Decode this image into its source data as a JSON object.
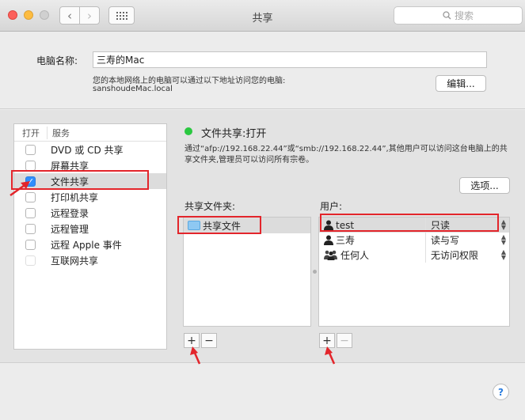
{
  "window": {
    "title": "共享",
    "search_placeholder": "搜索"
  },
  "computer": {
    "label": "电脑名称:",
    "name": "三寿的Mac",
    "hint": "您的本地网络上的电脑可以通过以下地址访问您的电脑:",
    "address": "sanshoudeMac.local",
    "edit_label": "编辑..."
  },
  "services": {
    "col_on": "打开",
    "col_service": "服务",
    "items": [
      {
        "label": "DVD 或 CD 共享",
        "checked": false
      },
      {
        "label": "屏幕共享",
        "checked": false
      },
      {
        "label": "文件共享",
        "checked": true
      },
      {
        "label": "打印机共享",
        "checked": false
      },
      {
        "label": "远程登录",
        "checked": false
      },
      {
        "label": "远程管理",
        "checked": false
      },
      {
        "label": "远程 Apple 事件",
        "checked": false
      },
      {
        "label": "互联网共享",
        "checked": false
      }
    ]
  },
  "file_sharing": {
    "status": "文件共享:打开",
    "description": "通过“afp://192.168.22.44”或“smb://192.168.22.44”,其他用户可以访问这台电脑上的共享文件夹,管理员可以访问所有宗卷。",
    "options_label": "选项...",
    "folders_label": "共享文件夹:",
    "folders": [
      "共享文件"
    ],
    "users_label": "用户:",
    "users": [
      {
        "name": "test",
        "permission": "只读"
      },
      {
        "name": "三寿",
        "permission": "读与写"
      },
      {
        "name": "任何人",
        "permission": "无访问权限"
      }
    ],
    "add_glyph": "+",
    "remove_glyph": "−"
  },
  "help_glyph": "?",
  "colors": {
    "annotation_red": "#e3252b",
    "checkbox_blue": "#2f8efc",
    "status_green": "#2ac840"
  }
}
